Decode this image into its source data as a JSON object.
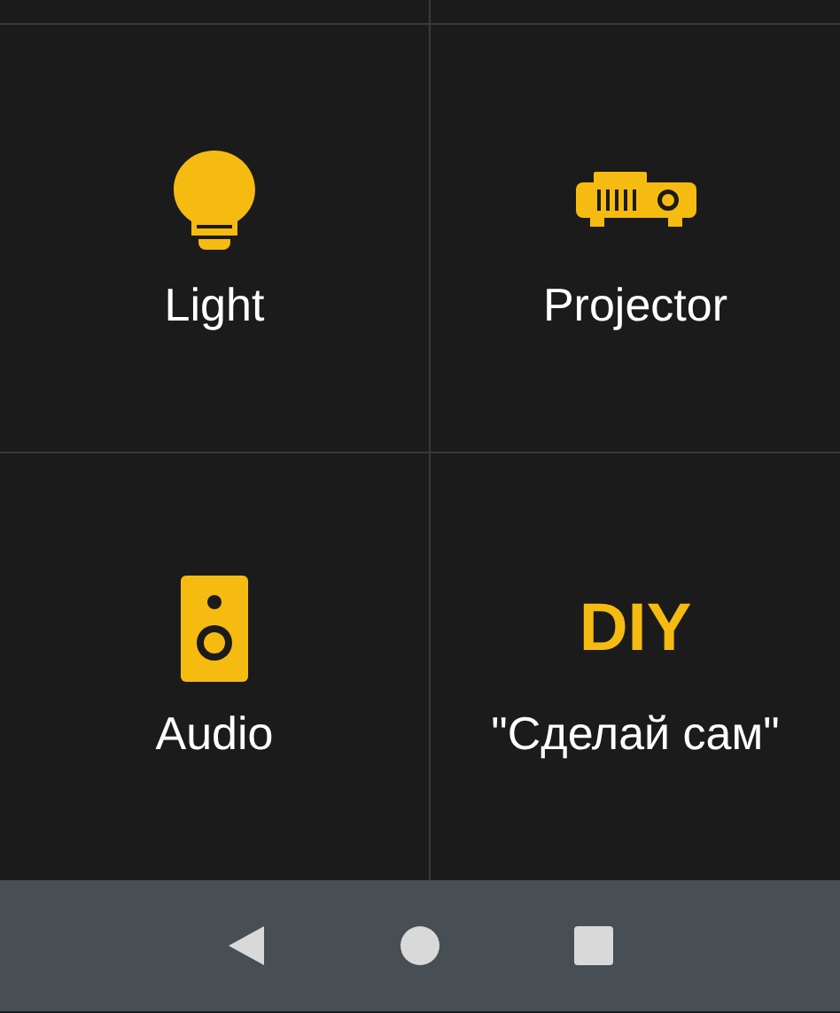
{
  "tile_rows": [
    {
      "tiles": [
        {
          "kind": "bulb",
          "label": "Light"
        },
        {
          "kind": "projector",
          "label": "Projector"
        }
      ]
    },
    {
      "tiles": [
        {
          "kind": "speaker",
          "label": "Audio"
        },
        {
          "kind": "text",
          "icon_text": "DIY",
          "label": "\"Сделай сам\""
        }
      ]
    }
  ]
}
